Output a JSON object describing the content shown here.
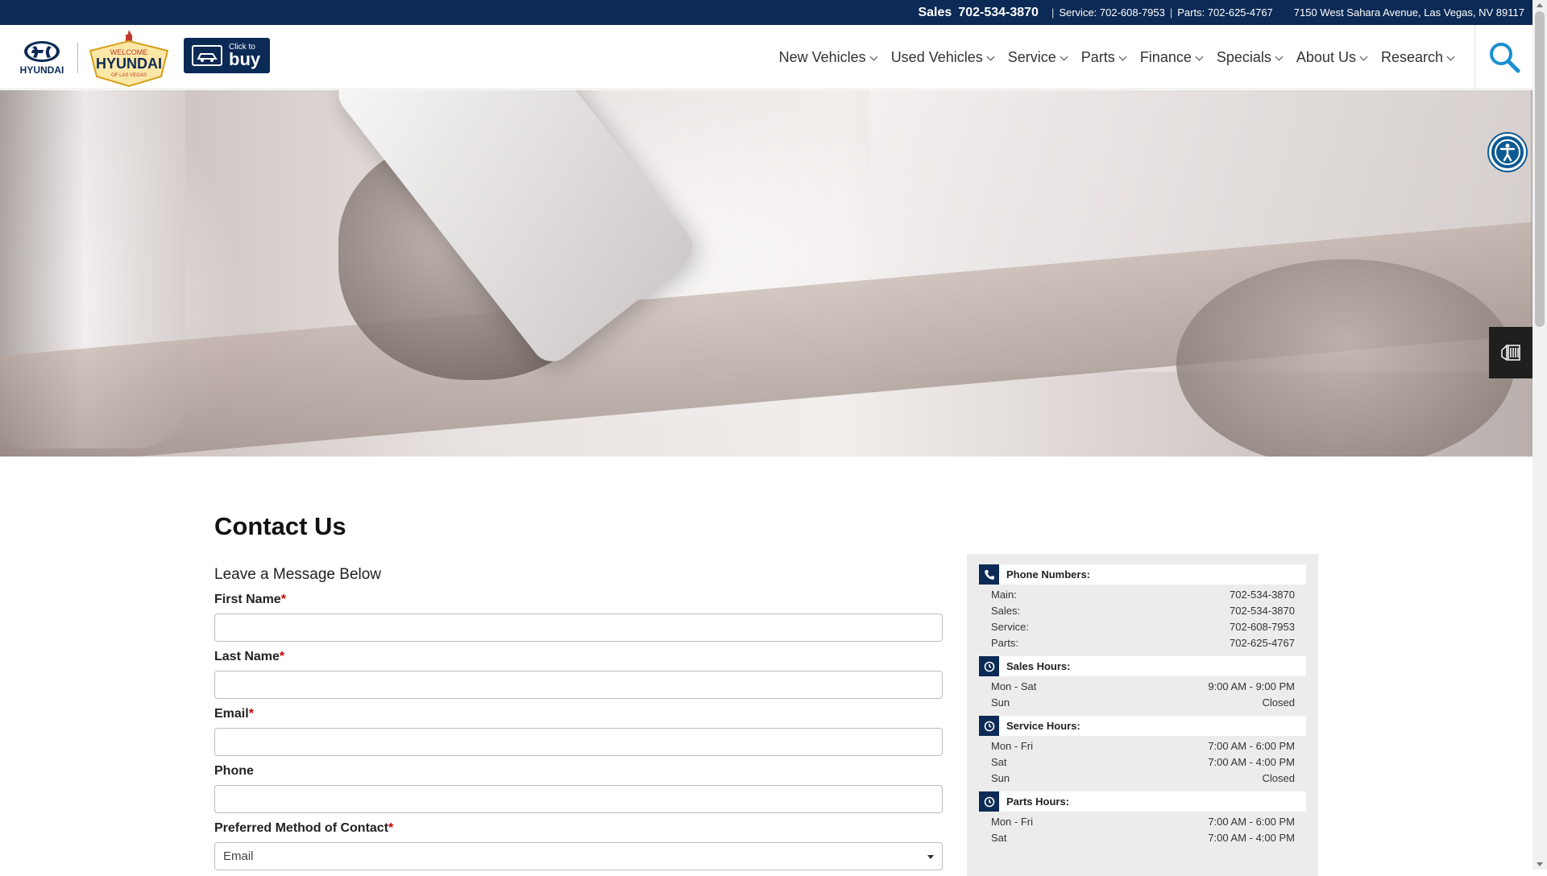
{
  "topbar": {
    "sales_label": "Sales",
    "sales_phone": "702-534-3870",
    "service": "Service: 702-608-7953",
    "parts": "Parts: 702-625-4767",
    "address": "7150 West Sahara Avenue, Las Vegas, NV 89117"
  },
  "header": {
    "brand": "HYUNDAI",
    "dealer_logo_top": "WELCOME",
    "dealer_logo_main": "HYUNDAI",
    "dealer_logo_bottom": "OF LAS VEGAS",
    "click_small": "Click to",
    "click_big": "buy"
  },
  "nav": {
    "items": [
      "New Vehicles",
      "Used Vehicles",
      "Service",
      "Parts",
      "Finance",
      "Specials",
      "About Us",
      "Research"
    ]
  },
  "page": {
    "title": "Contact Us",
    "subtitle": "Leave a Message Below"
  },
  "form": {
    "first_name_label": "First Name",
    "last_name_label": "Last Name",
    "email_label": "Email",
    "phone_label": "Phone",
    "preferred_label": "Preferred Method of Contact",
    "required_mark": "*",
    "preferred_value": "Email"
  },
  "info": {
    "phone_title": "Phone Numbers:",
    "phones": [
      {
        "label": "Main:",
        "value": "702-534-3870"
      },
      {
        "label": "Sales:",
        "value": "702-534-3870"
      },
      {
        "label": "Service:",
        "value": "702-608-7953"
      },
      {
        "label": "Parts:",
        "value": "702-625-4767"
      }
    ],
    "sales_title": "Sales Hours:",
    "sales_hours": [
      {
        "label": "Mon - Sat",
        "value": "9:00 AM - 9:00 PM"
      },
      {
        "label": "Sun",
        "value": "Closed"
      }
    ],
    "service_title": "Service Hours:",
    "service_hours": [
      {
        "label": "Mon - Fri",
        "value": "7:00 AM - 6:00 PM"
      },
      {
        "label": "Sat",
        "value": "7:00 AM - 4:00 PM"
      },
      {
        "label": "Sun",
        "value": "Closed"
      }
    ],
    "parts_title": "Parts Hours:",
    "parts_hours": [
      {
        "label": "Mon - Fri",
        "value": "7:00 AM - 6:00 PM"
      },
      {
        "label": "Sat",
        "value": "7:00 AM - 4:00 PM"
      }
    ]
  },
  "colors": {
    "navy": "#0b2a55",
    "accent_blue": "#1a8fd1",
    "required": "#cc0000"
  }
}
